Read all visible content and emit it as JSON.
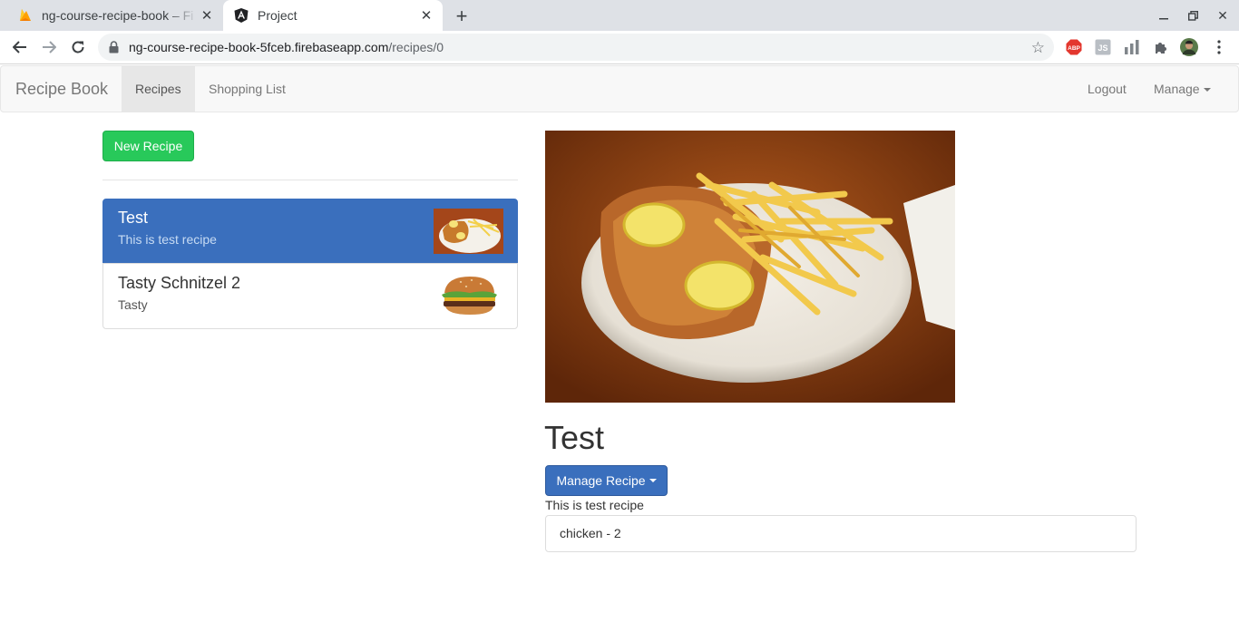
{
  "browser": {
    "tabs": [
      {
        "title": "ng-course-recipe-book – Fi",
        "icon": "firebase-icon",
        "active": false
      },
      {
        "title": "Project",
        "icon": "angular-icon",
        "active": true
      }
    ],
    "url_host": "ng-course-recipe-book-5fceb.firebaseapp.com",
    "url_path": "/recipes/0"
  },
  "navbar": {
    "brand": "Recipe Book",
    "items": [
      {
        "label": "Recipes"
      },
      {
        "label": "Shopping List"
      }
    ],
    "right": {
      "logout": "Logout",
      "manage": "Manage"
    }
  },
  "sidebar": {
    "new_recipe_label": "New Recipe",
    "recipes": [
      {
        "name": "Test",
        "description": "This is test recipe",
        "image": "schnitzel-photo"
      },
      {
        "name": "Tasty Schnitzel 2",
        "description": "Tasty",
        "image": "burger-photo"
      }
    ]
  },
  "detail": {
    "name": "Test",
    "manage_label": "Manage Recipe",
    "description": "This is test recipe",
    "ingredients": [
      "chicken - 2"
    ]
  },
  "colors": {
    "primary": "#3a6fbd",
    "success": "#28c95a",
    "navbar_bg": "#f8f8f8"
  }
}
